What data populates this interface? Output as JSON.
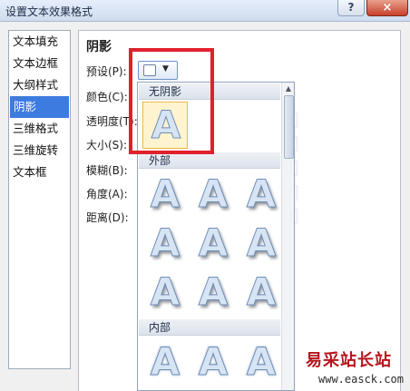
{
  "window": {
    "title": "设置文本效果格式",
    "help_label": "?",
    "close_label": "×"
  },
  "sidebar": {
    "items": [
      {
        "label": "文本填充",
        "active": false
      },
      {
        "label": "文本边框",
        "active": false
      },
      {
        "label": "大纲样式",
        "active": false
      },
      {
        "label": "阴影",
        "active": true
      },
      {
        "label": "三维格式",
        "active": false
      },
      {
        "label": "三维旋转",
        "active": false
      },
      {
        "label": "文本框",
        "active": false
      }
    ]
  },
  "shadow_panel": {
    "title": "阴影",
    "preset_label": "预设(P):",
    "color_label": "颜色(C):",
    "transparency_label": "透明度(T):",
    "size_label": "大小(S):",
    "blur_label": "模糊(B):",
    "angle_label": "角度(A):",
    "distance_label": "距离(D):"
  },
  "preset_gallery": {
    "sections": [
      {
        "header": "无阴影",
        "style": "none",
        "rows": 1
      },
      {
        "header": "外部",
        "style": "outer",
        "rows": 3
      },
      {
        "header": "内部",
        "style": "inner",
        "rows": 1
      }
    ],
    "glyph": "A",
    "selected_section": "无阴影"
  },
  "watermark": {
    "brand": "易采站长站",
    "url": "www.easck.com"
  },
  "colors": {
    "highlight_box": "#e0212d",
    "selection_blue": "#3d7be0",
    "tile_hover": "#fff4cf"
  }
}
